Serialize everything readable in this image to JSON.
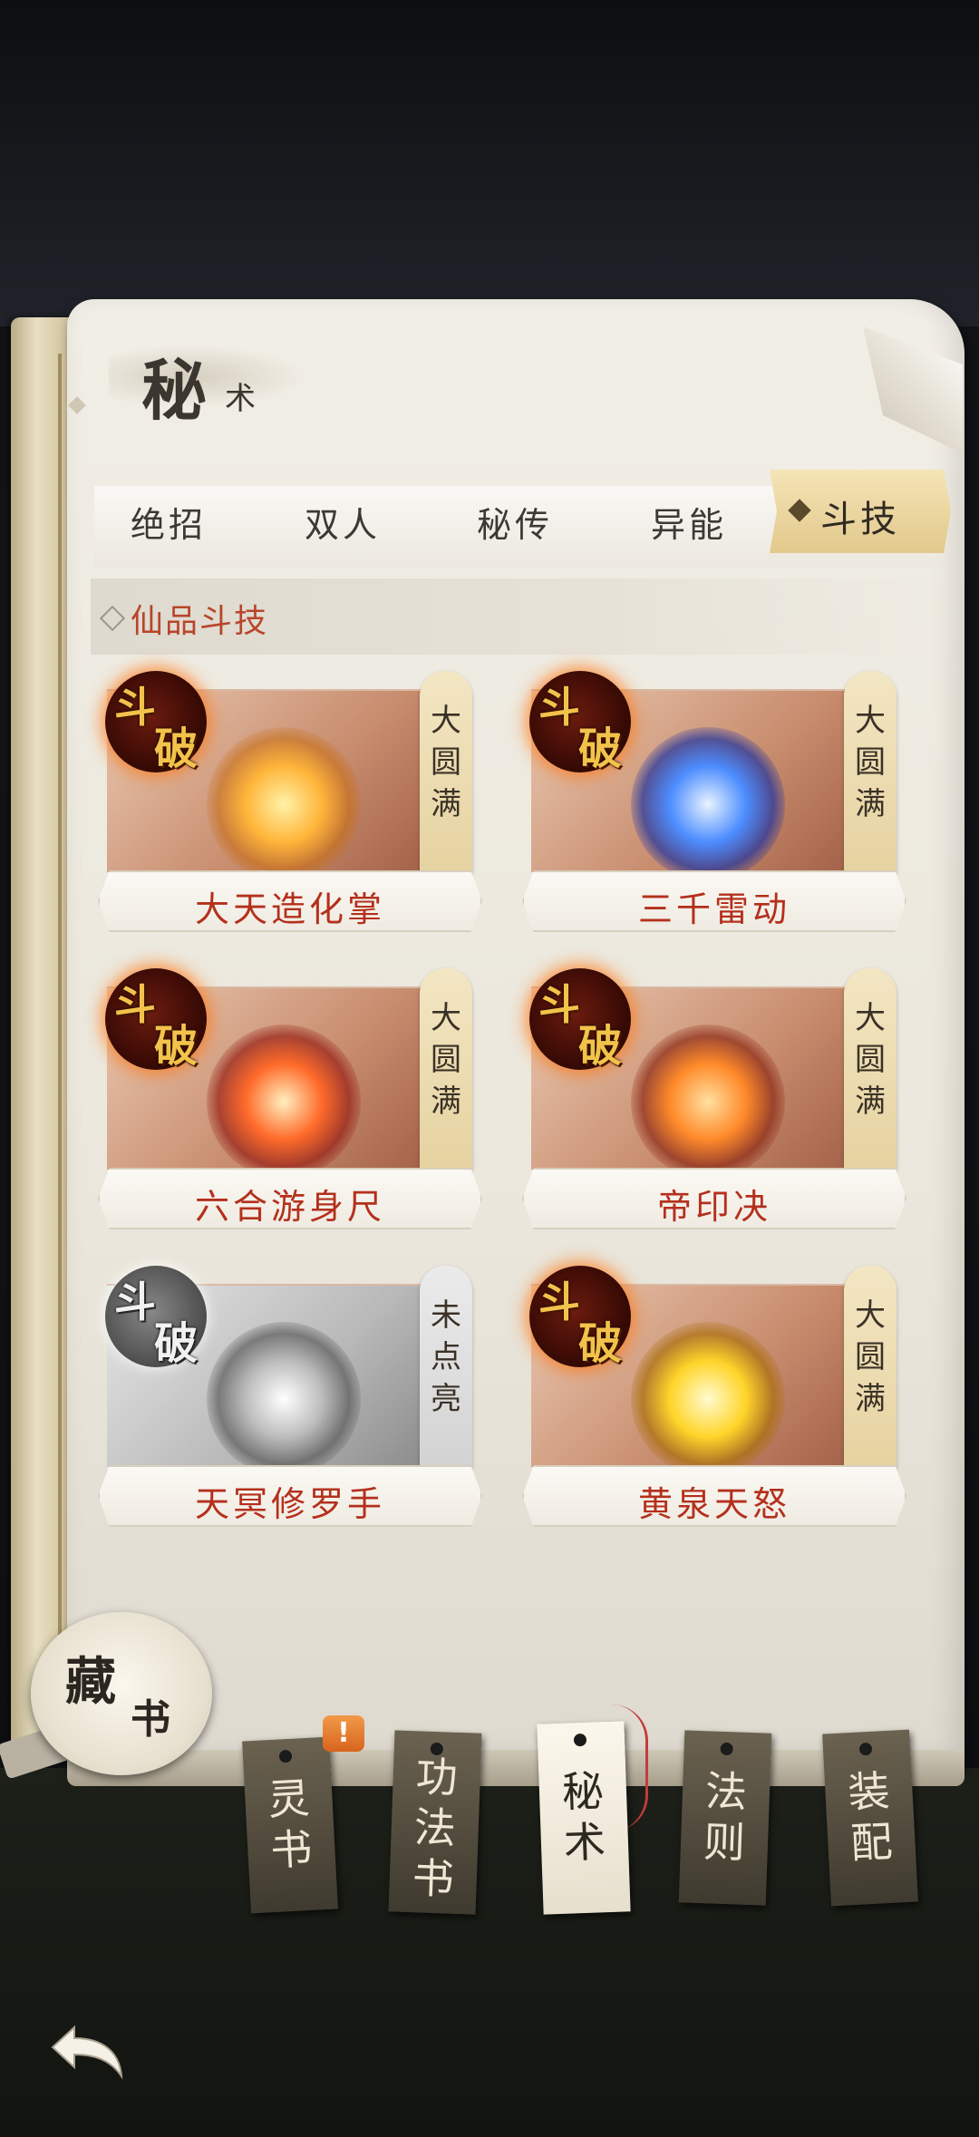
{
  "header": {
    "title_main": "秘",
    "title_sub": "术"
  },
  "tabs": [
    {
      "label": "绝招"
    },
    {
      "label": "双人"
    },
    {
      "label": "秘传"
    },
    {
      "label": "异能"
    },
    {
      "label": "斗技",
      "active": true
    }
  ],
  "section": {
    "title": "仙品斗技"
  },
  "cards": [
    {
      "name": "大天造化掌",
      "badge_1": "斗",
      "badge_2": "破",
      "status": "大圆满",
      "glow": "#ffb53a"
    },
    {
      "name": "三千雷动",
      "badge_1": "斗",
      "badge_2": "破",
      "status": "大圆满",
      "glow": "#4d8dff"
    },
    {
      "name": "六合游身尺",
      "badge_1": "斗",
      "badge_2": "破",
      "status": "大圆满",
      "glow": "#ff6a2a"
    },
    {
      "name": "帝印决",
      "badge_1": "斗",
      "badge_2": "破",
      "status": "大圆满",
      "glow": "#ff8a2a"
    },
    {
      "name": "天冥修罗手",
      "badge_1": "斗",
      "badge_2": "破",
      "status": "未点亮",
      "glow": "#ffffff"
    },
    {
      "name": "黄泉天怒",
      "badge_1": "斗",
      "badge_2": "破",
      "status": "大圆满",
      "glow": "#ffd52a"
    }
  ],
  "collection": {
    "label_1": "藏",
    "label_2": "书"
  },
  "nav": [
    {
      "label": "灵书",
      "alert": "!"
    },
    {
      "label": "功法书"
    },
    {
      "label": "秘术",
      "active": true
    },
    {
      "label": "法则"
    },
    {
      "label": "装配"
    }
  ],
  "colors": {
    "accent_red": "#b4301c",
    "gold": "#f3c24a",
    "tab_active": "#e2c98c"
  }
}
